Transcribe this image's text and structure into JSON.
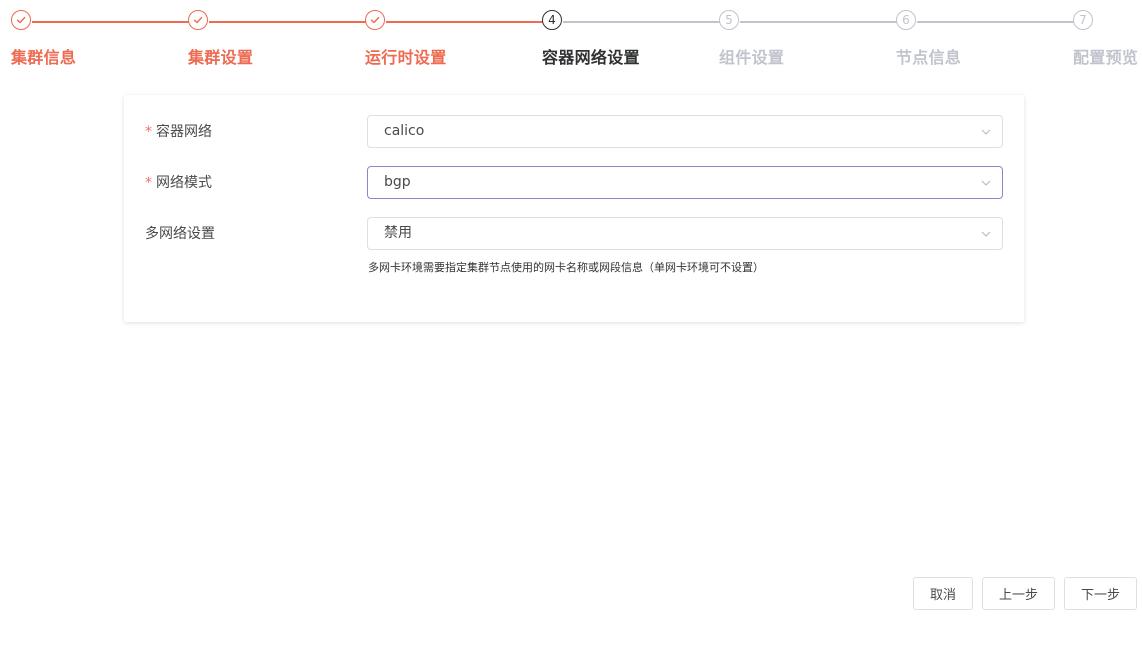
{
  "steps": [
    {
      "number": "1",
      "title": "集群信息",
      "status": "finish"
    },
    {
      "number": "2",
      "title": "集群设置",
      "status": "finish"
    },
    {
      "number": "3",
      "title": "运行时设置",
      "status": "finish"
    },
    {
      "number": "4",
      "title": "容器网络设置",
      "status": "process"
    },
    {
      "number": "5",
      "title": "组件设置",
      "status": "wait"
    },
    {
      "number": "6",
      "title": "节点信息",
      "status": "wait"
    },
    {
      "number": "7",
      "title": "配置预览",
      "status": "wait"
    }
  ],
  "form": {
    "required_mark": "*",
    "container_network": {
      "label": "容器网络",
      "value": "calico"
    },
    "network_mode": {
      "label": "网络模式",
      "value": "bgp"
    },
    "multi_network": {
      "label": "多网络设置",
      "value": "禁用"
    },
    "hint": "多网卡环境需要指定集群节点使用的网卡名称或网段信息（单网卡环境可不设置）"
  },
  "buttons": {
    "cancel": "取消",
    "prev": "上一步",
    "next": "下一步"
  },
  "colors": {
    "finish": "#ee6a50",
    "process": "#303133",
    "wait": "#c0c4cc"
  }
}
